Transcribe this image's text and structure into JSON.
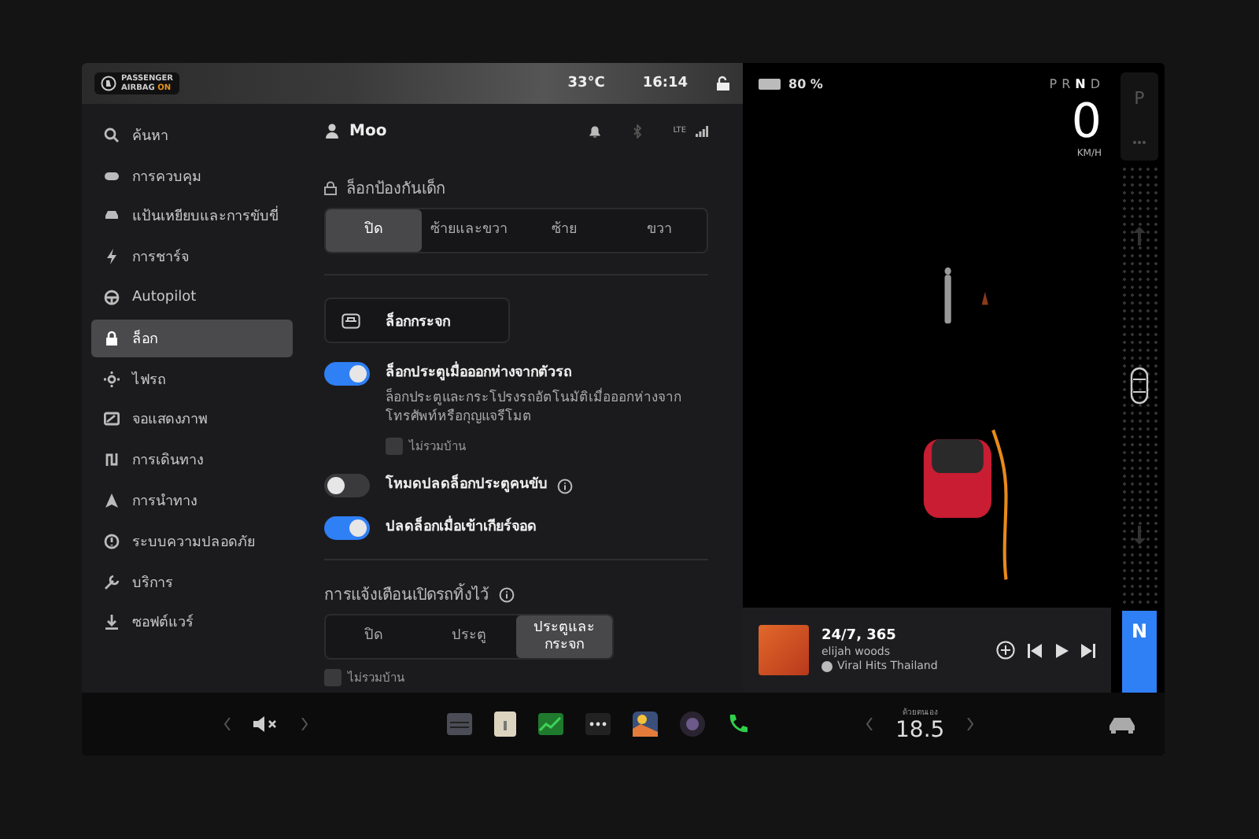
{
  "status_bar": {
    "airbag_line1": "PASSENGER",
    "airbag_line2": "AIRBAG",
    "airbag_state": "ON",
    "temperature": "33°C",
    "time": "16:14"
  },
  "sidebar": {
    "items": [
      {
        "label": "ค้นหา",
        "selected": false
      },
      {
        "label": "การควบคุม",
        "selected": false
      },
      {
        "label": "แป้นเหยียบและการขับขี่",
        "selected": false
      },
      {
        "label": "การชาร์จ",
        "selected": false
      },
      {
        "label": "Autopilot",
        "selected": false
      },
      {
        "label": "ล็อก",
        "selected": true
      },
      {
        "label": "ไฟรถ",
        "selected": false
      },
      {
        "label": "จอแสดงภาพ",
        "selected": false
      },
      {
        "label": "การเดินทาง",
        "selected": false
      },
      {
        "label": "การนำทาง",
        "selected": false
      },
      {
        "label": "ระบบความปลอดภัย",
        "selected": false
      },
      {
        "label": "บริการ",
        "selected": false
      },
      {
        "label": "ซอฟต์แวร์",
        "selected": false
      }
    ]
  },
  "header": {
    "profile": "Moo",
    "network": "LTE"
  },
  "child_lock": {
    "label": "ล็อกป้องกันเด็ก",
    "options": [
      {
        "label": "ปิด",
        "selected": true
      },
      {
        "label": "ซ้ายและขวา",
        "selected": false
      },
      {
        "label": "ซ้าย",
        "selected": false
      },
      {
        "label": "ขวา",
        "selected": false
      }
    ]
  },
  "window_lock_button": "ล็อกกระจก",
  "toggles": [
    {
      "label": "ล็อกประตูเมื่อออกห่างจากตัวรถ",
      "description": "ล็อกประตูและกระโปรงรถอัตโนมัติเมื่อออกห่างจากโทรศัพท์หรือกุญแจรีโมต",
      "on": true,
      "info": false,
      "checkbox": {
        "label": "ไม่รวมบ้าน",
        "checked": false
      }
    },
    {
      "label": "โหมดปลดล็อกประตูคนขับ",
      "on": false,
      "info": true
    },
    {
      "label": "ปลดล็อกเมื่อเข้าเกียร์จอด",
      "on": true,
      "info": false
    }
  ],
  "open_alert": {
    "label": "การแจ้งเตือนเปิดรถทิ้งไว้",
    "options": [
      {
        "label": "ปิด",
        "selected": false
      },
      {
        "label": "ประตู",
        "selected": false
      },
      {
        "label": "ประตูและกระจก",
        "selected": true
      }
    ],
    "checkbox": {
      "label": "ไม่รวมบ้าน",
      "checked": false
    }
  },
  "drive": {
    "battery": "80 %",
    "gears": [
      {
        "label": "P",
        "selected": false
      },
      {
        "label": "R",
        "selected": false
      },
      {
        "label": "N",
        "selected": true
      },
      {
        "label": "D",
        "selected": false
      }
    ],
    "speed": "0",
    "speed_unit": "KM/H",
    "shifter_top": "P",
    "shifter_current": "N"
  },
  "media": {
    "title": "24/7, 365",
    "artist": "elijah woods",
    "source": "Viral Hits Thailand"
  },
  "taskbar": {
    "climate_label": "ด้วยตนเอง",
    "temperature": "18.5"
  }
}
